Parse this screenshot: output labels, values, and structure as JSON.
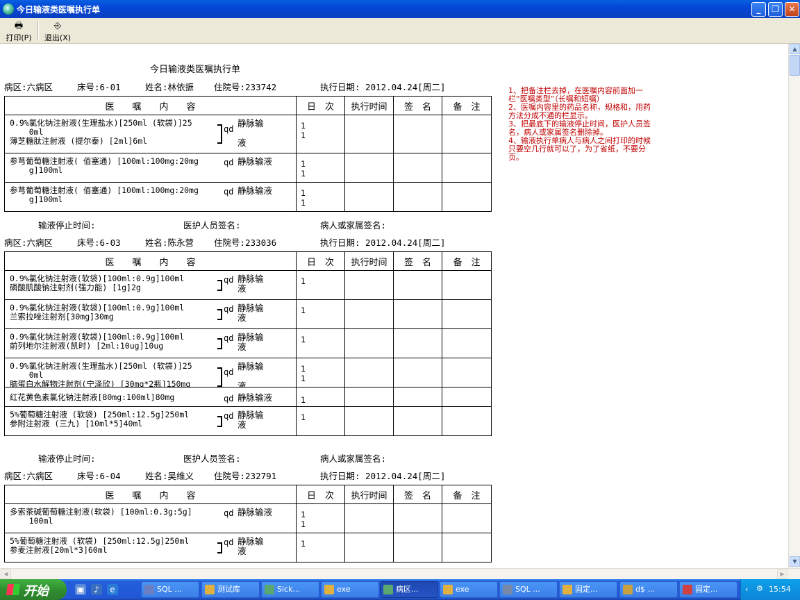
{
  "window": {
    "title": "今日输液类医嘱执行单"
  },
  "toolbar": {
    "print_label": "打印(P)",
    "exit_label": "退出(X)"
  },
  "document": {
    "title": "今日输液类医嘱执行单",
    "headers": {
      "content": "医　　嘱　　内　　容",
      "times": "日　次",
      "exec_time": "执行时间",
      "sign": "签　名",
      "remark": "备　注"
    },
    "signature_line": {
      "stop_time": "输液停止时间:",
      "staff_sign": "医护人员签名:",
      "patient_sign": "病人或家属签名:"
    },
    "patients": [
      {
        "ward": "病区:六病区",
        "bed": "床号:6-01",
        "name": "姓名:林依振",
        "admission": "住院号:233742",
        "exec_date": "执行日期: 2012.04.24[周二]",
        "orders": [
          {
            "drug": "0.9%氯化钠注射液(生理盐水)[250ml (软袋)]25\n    0ml\n薄芝糖肽注射液 (提尔泰) [2ml]6ml",
            "freq": "qd",
            "route": "静脉输\n\n液",
            "times": [
              "1",
              "1"
            ]
          },
          {
            "drug": "参芎葡萄糖注射液( 佰塞通) [100ml:100mg:20mg\n    g]100ml",
            "freq": "qd",
            "route": "静脉输液",
            "times": [
              "1",
              "1"
            ]
          },
          {
            "drug": "参芎葡萄糖注射液( 佰塞通) [100ml:100mg:20mg\n    g]100ml",
            "freq": "qd",
            "route": "静脉输液",
            "times": [
              "1",
              "1"
            ]
          }
        ]
      },
      {
        "ward": "病区:六病区",
        "bed": "床号:6-03",
        "name": "姓名:陈永营",
        "admission": "住院号:233036",
        "exec_date": "执行日期: 2012.04.24[周二]",
        "orders": [
          {
            "drug": "0.9%氯化钠注射液(软袋)[100ml:0.9g]100ml\n磷酸肌酸钠注射剂(强力能) [1g]2g",
            "freq": "qd",
            "route": "静脉输\n液",
            "times": [
              "1"
            ]
          },
          {
            "drug": "0.9%氯化钠注射液(软袋)[100ml:0.9g]100ml\n兰索拉唑注射剂[30mg]30mg",
            "freq": "qd",
            "route": "静脉输\n液",
            "times": [
              "1"
            ]
          },
          {
            "drug": "0.9%氯化钠注射液(软袋)[100ml:0.9g]100ml\n前列地尔注射液(凯时) [2ml:10ug]10ug",
            "freq": "qd",
            "route": "静脉输\n液",
            "times": [
              "1"
            ]
          },
          {
            "drug": "0.9%氯化钠注射液(生理盐水)[250ml (软袋)]25\n    0ml\n脑蛋白水解物注射剂(宁泽欣) [30mg*2瓶]150mg",
            "freq": "qd",
            "route": "静脉输\n\n液",
            "times": [
              "1",
              "1"
            ]
          },
          {
            "drug": "红花黄色素氯化钠注射液[80mg:100ml]80mg",
            "freq": "qd",
            "route": "静脉输液",
            "times": [
              "1"
            ]
          },
          {
            "drug": "5%葡萄糖注射液 (软袋) [250ml:12.5g]250ml\n参附注射液 (三九) [10ml*5]40ml",
            "freq": "qd",
            "route": "静脉输\n液",
            "times": [
              "1"
            ]
          }
        ]
      },
      {
        "ward": "病区:六病区",
        "bed": "床号:6-04",
        "name": "姓名:吴维义",
        "admission": "住院号:232791",
        "exec_date": "执行日期: 2012.04.24[周二]",
        "orders": [
          {
            "drug": "多索茶碱葡萄糖注射液(软袋) [100ml:0.3g:5g]\n    100ml",
            "freq": "qd",
            "route": "静脉输液",
            "times": [
              "1",
              "1"
            ]
          },
          {
            "drug": "5%葡萄糖注射液 (软袋) [250ml:12.5g]250ml\n参麦注射液[20ml*3]60ml",
            "freq": "qd",
            "route": "静脉输\n液",
            "times": [
              "1"
            ]
          }
        ]
      }
    ]
  },
  "notes": "1、把备注栏去掉，在医嘱内容前面加一栏“医嘱类型”（长嘱和短嘱）\n2、医嘱内容里的药品名称，规格和，用药方法分成不通的栏显示。\n3、把最底下的输液停止时间，医护人员签名，病人或家属签名删除掉。\n4、输液执行单病人与病人之间打印的时候只要空几行就可以了，为了省纸，不要分页。",
  "taskbar": {
    "start_label": "开始",
    "tasks": [
      "SQL ...",
      "测试库",
      "Sick...",
      "exe",
      "病区...",
      "exe",
      "SQL ...",
      "固定...",
      "d$ ...",
      "固定..."
    ],
    "active_task": "病区...",
    "clock": "15:54"
  },
  "colors": {
    "titlebar": "#0a5fe0",
    "note_text": "#c00000",
    "taskbar": "#245edb",
    "start": "#3c9a3c"
  }
}
